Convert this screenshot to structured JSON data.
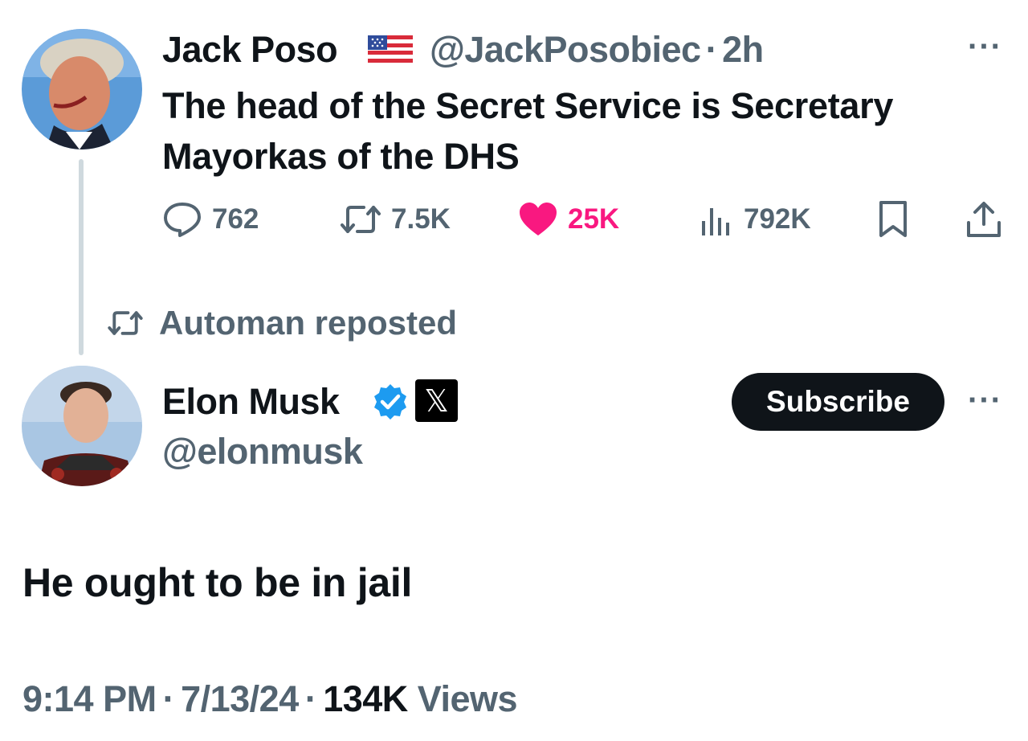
{
  "quoted_post": {
    "author_name": "Jack Poso",
    "author_flag": "us-flag-icon",
    "author_handle": "@JackPosobiec",
    "separator": "·",
    "time_ago": "2h",
    "text": "The head of the Secret Service is Secretary Mayorkas of the DHS",
    "stats": {
      "replies": "762",
      "reposts": "7.5K",
      "likes": "25K",
      "views": "792K"
    }
  },
  "repost_banner": {
    "text": "Automan reposted"
  },
  "main_post": {
    "author_name": "Elon Musk",
    "author_handle": "@elonmusk",
    "subscribe_label": "Subscribe",
    "text": "He ought to be in jail",
    "timestamp_time": "9:14 PM",
    "separator": "·",
    "timestamp_date": "7/13/24",
    "views_count": "134K",
    "views_label": "Views"
  },
  "colors": {
    "text_primary": "#0f1419",
    "text_secondary": "#536471",
    "like_pink": "#f91880",
    "verified_blue": "#1d9bf0",
    "thread_line": "#cfd9de"
  }
}
